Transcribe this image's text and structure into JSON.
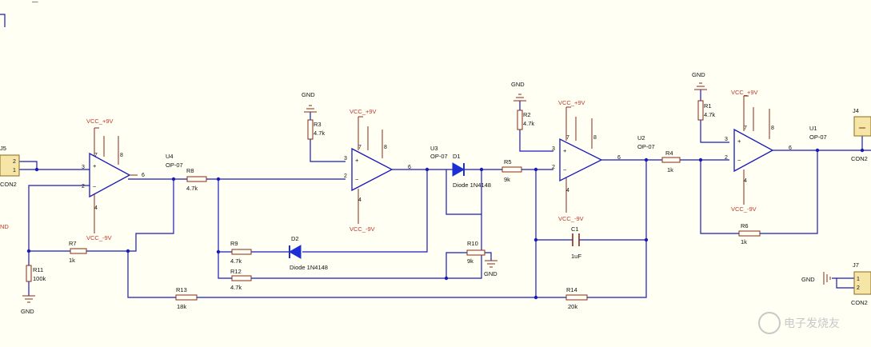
{
  "components": {
    "U1": {
      "ref": "U1",
      "type": "OP-07",
      "vcc": "VCC_+9V",
      "vee": "VCC_-9V",
      "pins": {
        "in_plus": "3",
        "in_minus": "2",
        "out": "6",
        "p7": "7",
        "p8": "8",
        "p4": "4"
      }
    },
    "U2": {
      "ref": "U2",
      "type": "OP-07",
      "vcc": "VCC_+9V",
      "vee": "VCC_-9V",
      "pins": {
        "in_plus": "3",
        "in_minus": "2",
        "out": "6",
        "p7": "7",
        "p8": "8",
        "p4": "4"
      }
    },
    "U3": {
      "ref": "U3",
      "type": "OP-07",
      "vcc": "VCC_+9V",
      "vee": "VCC_-9V",
      "pins": {
        "in_plus": "3",
        "in_minus": "2",
        "out": "6",
        "p7": "7",
        "p8": "8",
        "p4": "4"
      }
    },
    "U4": {
      "ref": "U4",
      "type": "OP-07",
      "vcc": "VCC_+9V",
      "vee": "VCC_-9V",
      "pins": {
        "in_plus": "3",
        "in_minus": "2",
        "out": "6",
        "p7": "7",
        "p8": "8",
        "p4": "4"
      }
    },
    "R1": {
      "ref": "R1",
      "value": "4.7k"
    },
    "R2": {
      "ref": "R2",
      "value": "4.7k"
    },
    "R3": {
      "ref": "R3",
      "value": "4.7k"
    },
    "R4": {
      "ref": "R4",
      "value": "1k"
    },
    "R5": {
      "ref": "R5",
      "value": "9k"
    },
    "R6": {
      "ref": "R6",
      "value": "1k"
    },
    "R7": {
      "ref": "R7",
      "value": "1k"
    },
    "R8": {
      "ref": "R8",
      "value": "4.7k"
    },
    "R9": {
      "ref": "R9",
      "value": "4.7k"
    },
    "R10": {
      "ref": "R10",
      "value": "9k"
    },
    "R11": {
      "ref": "R11",
      "value": "100k"
    },
    "R12": {
      "ref": "R12",
      "value": "4.7k"
    },
    "R13": {
      "ref": "R13",
      "value": "18k"
    },
    "R14": {
      "ref": "R14",
      "value": "20k"
    },
    "C1": {
      "ref": "C1",
      "value": "1uF"
    },
    "D1": {
      "ref": "D1",
      "value": "Diode 1N4148"
    },
    "D2": {
      "ref": "D2",
      "value": "Diode 1N4148"
    },
    "J5": {
      "ref": "J5",
      "value": "CON2",
      "pin1": "1",
      "pin2": "2"
    },
    "J7": {
      "ref": "J7",
      "value": "CON2",
      "pin1": "1",
      "pin2": "2"
    },
    "J4": {
      "ref": "J4",
      "value": "CON2"
    }
  },
  "gnd_label": "GND",
  "edge_labels": {
    "left_partial": "ND",
    "topleft_partial": "—"
  },
  "watermark": "电子发烧友",
  "colors": {
    "background": "#fffff4",
    "wire": "#1a1ab8",
    "symbol": "#8a2a1a",
    "diode": "#1c2fd4",
    "text": "#111111",
    "net_label": "#c0392b"
  }
}
